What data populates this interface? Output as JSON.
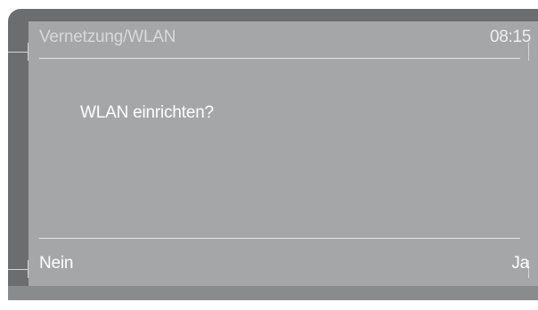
{
  "header": {
    "title": "Vernetzung/WLAN",
    "time": "08:15"
  },
  "dialog": {
    "question": "WLAN einrichten?"
  },
  "softkeys": {
    "left_label": "Nein",
    "right_label": "Ja"
  }
}
